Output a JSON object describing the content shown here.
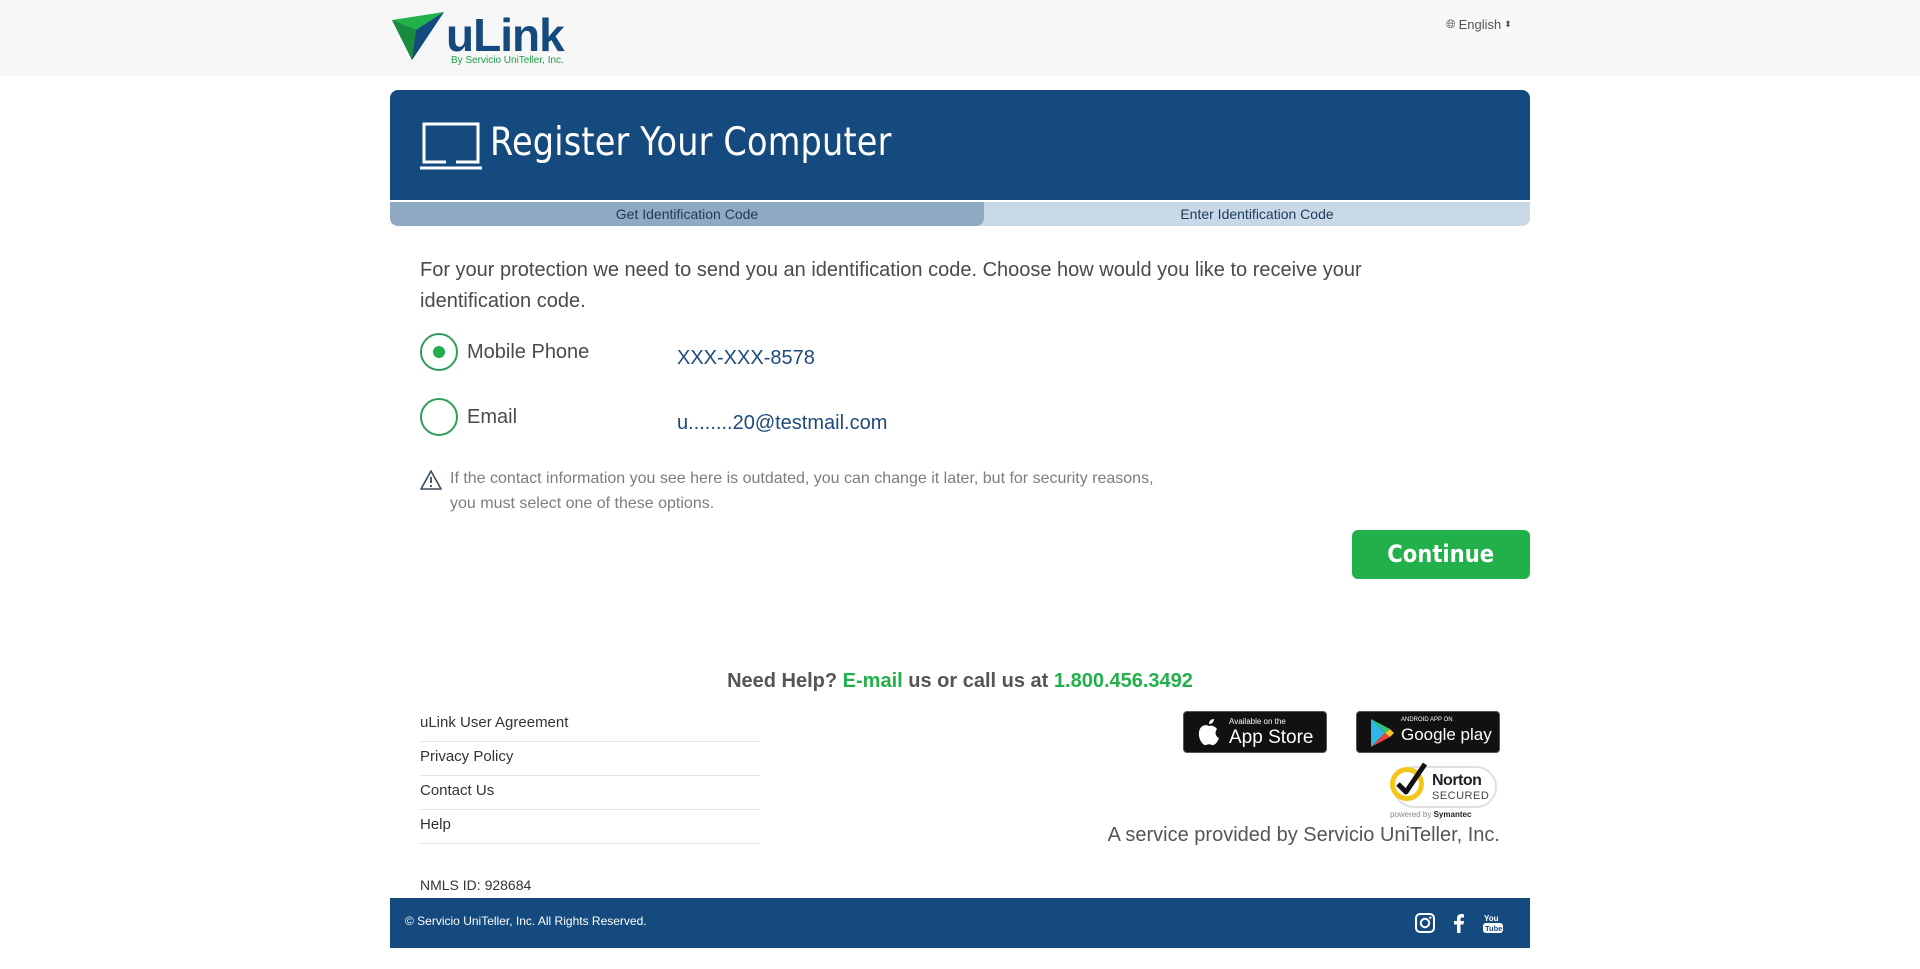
{
  "header": {
    "logo_text": "uLink",
    "logo_subtitle": "By Servicio UniTeller, Inc.",
    "language": "English"
  },
  "page": {
    "title": "Register Your Computer"
  },
  "steps": [
    {
      "label": "Get Identification Code",
      "active": true
    },
    {
      "label": "Enter Identification Code",
      "active": false
    }
  ],
  "form": {
    "intro": "For your protection we need to send you an identification code. Choose how would you like to receive your identification code.",
    "options": [
      {
        "label": "Mobile Phone",
        "value": "XXX-XXX-8578",
        "selected": true
      },
      {
        "label": "Email",
        "value": "u........20@testmail.com",
        "selected": false
      }
    ],
    "warning": "If the contact information you see here is outdated, you can change it later, but for security reasons, you must select one of these options.",
    "continue_label": "Continue"
  },
  "help": {
    "prefix": "Need Help?",
    "email_link": "E-mail",
    "middle": "us or call us at",
    "phone": "1.800.456.3492"
  },
  "footer": {
    "links": [
      "uLink User Agreement",
      "Privacy Policy",
      "Contact Us",
      "Help"
    ],
    "nmls": "NMLS ID: 928684",
    "appstore": {
      "small": "Available on the",
      "big": "App Store"
    },
    "googleplay": {
      "small": "ANDROID APP ON",
      "big": "Google play"
    },
    "norton": {
      "name": "Norton",
      "secured": "SECURED",
      "powered_prefix": "powered by",
      "powered_brand": "Symantec"
    },
    "service": "A service provided by Servicio UniTeller, Inc.",
    "copyright": "© Servicio UniTeller, Inc. All Rights Reserved."
  },
  "colors": {
    "brand_blue": "#144a7e",
    "brand_green": "#22b04b"
  }
}
